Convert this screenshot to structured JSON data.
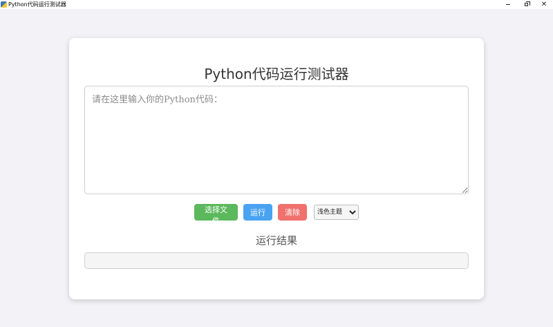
{
  "window": {
    "title": "Python代码运行测试器",
    "icon": "python-icon",
    "controls": {
      "minimize": "minimize-icon",
      "restore": "restore-icon",
      "close": "✕"
    }
  },
  "main": {
    "heading": "Python代码运行测试器",
    "code_input": {
      "value": "",
      "placeholder": "请在这里输入你的Python代码："
    },
    "buttons": {
      "choose_file": "选择文件",
      "run": "运行",
      "clear": "清除"
    },
    "theme_select": {
      "selected": "浅色主题"
    },
    "result": {
      "title": "运行结果",
      "output": ""
    }
  },
  "colors": {
    "page_background": "#f3f3f7",
    "choose_file_button": "#5cb85c",
    "run_button": "#4aa3f0",
    "clear_button": "#f0706b"
  }
}
